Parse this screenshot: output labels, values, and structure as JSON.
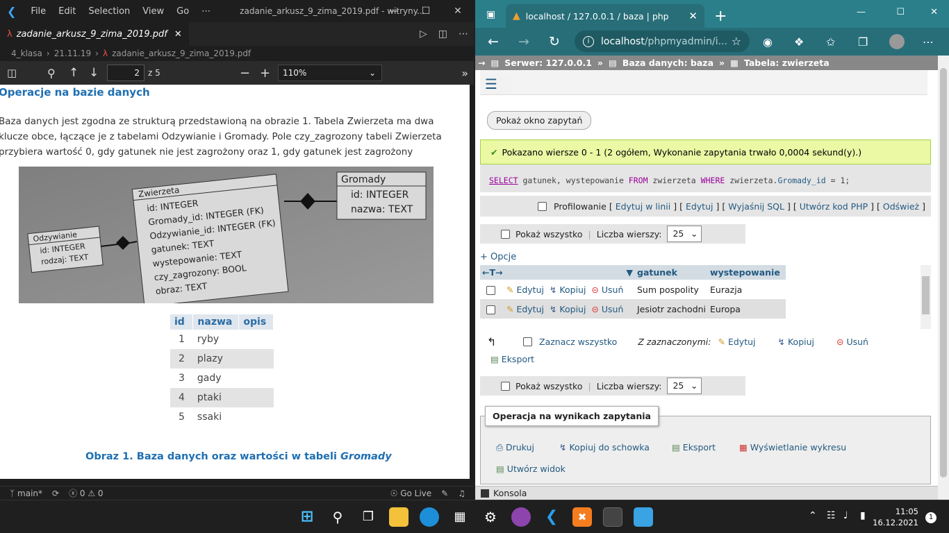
{
  "vscode": {
    "menu": [
      "File",
      "Edit",
      "Selection",
      "View",
      "Go",
      "⋯"
    ],
    "window_title": "zadanie_arkusz_9_zima_2019.pdf - witryny...",
    "tab_label": "zadanie_arkusz_9_zima_2019.pdf",
    "breadcrumb": [
      "4_klasa",
      "21.11.19",
      "zadanie_arkusz_9_zima_2019.pdf"
    ],
    "page_current": "2",
    "page_total": "z 5",
    "zoom": "110%",
    "status": {
      "branch": "main*",
      "problems": "ⓧ 0 ⚠ 0",
      "golive": "Go Live"
    }
  },
  "pdf": {
    "heading": "Operacje na bazie danych",
    "paragraph": "Baza danych jest zgodna ze strukturą przedstawioną na obrazie 1. Tabela Zwierzeta ma dwa klucze obce, łączące je z tabelami Odzywianie i Gromady. Pole czy_zagrozony tabeli Zwierzeta przybiera wartość 0, gdy gatunek nie jest zagrożony oraz 1, gdy gatunek jest zagrożony",
    "erd": {
      "odzywianie": {
        "title": "Odzywianie",
        "fields": [
          "id: INTEGER",
          "rodzaj: TEXT"
        ]
      },
      "zwierzeta": {
        "title": "Zwierzeta",
        "fields": [
          "id: INTEGER",
          "Gromady_id: INTEGER (FK)",
          "Odzywianie_id: INTEGER (FK)",
          "gatunek: TEXT",
          "wystepowanie: TEXT",
          "czy_zagrozony: BOOL",
          "obraz: TEXT"
        ]
      },
      "gromady": {
        "title": "Gromady",
        "fields": [
          "id: INTEGER",
          "nazwa: TEXT"
        ]
      }
    },
    "table": {
      "headers": [
        "id",
        "nazwa",
        "opis"
      ],
      "rows": [
        [
          "1",
          "ryby",
          ""
        ],
        [
          "2",
          "plazy",
          ""
        ],
        [
          "3",
          "gady",
          ""
        ],
        [
          "4",
          "ptaki",
          ""
        ],
        [
          "5",
          "ssaki",
          ""
        ]
      ]
    },
    "caption_prefix": "Obraz 1. Baza danych oraz wartości w tabeli ",
    "caption_italic": "Gromady"
  },
  "edge": {
    "tab_title": "localhost / 127.0.0.1 / baza | php",
    "url_host": "localhost",
    "url_path": "/phpmyadmin/i..."
  },
  "pma": {
    "breadcrumb": {
      "server": "Serwer: 127.0.0.1",
      "db": "Baza danych: baza",
      "table": "Tabela: zwierzeta"
    },
    "show_query_btn": "Pokaż okno zapytań",
    "success_msg": "Pokazano wiersze 0 - 1 (2 ogółem, Wykonanie zapytania trwało 0,0004 sekund(y).)",
    "sql": {
      "select": "SELECT",
      "cols": " gatunek, wystepowanie ",
      "from": "FROM",
      "tbl": " zwierzeta ",
      "where": "WHERE",
      "cond": " zwierzeta.",
      "col2": "Gromady_id",
      "eq": " = 1;"
    },
    "profiling": "Profilowanie",
    "profile_links": [
      "Edytuj w linii",
      "Edytuj",
      "Wyjaśnij SQL",
      "Utwórz kod PHP",
      "Odśwież"
    ],
    "show_all": "Pokaż wszystko",
    "rows_label": "Liczba wierszy:",
    "rows_value": "25",
    "options": "+ Opcje",
    "columns": [
      "gatunek",
      "wystepowanie"
    ],
    "row_actions": {
      "edit": "Edytuj",
      "copy": "Kopiuj",
      "delete": "Usuń"
    },
    "rows": [
      [
        "Sum pospolity",
        "Eurazja"
      ],
      [
        "Jesiotr zachodni",
        "Europa"
      ]
    ],
    "check_all": "Zaznacz wszystko",
    "with_selected": "Z zaznaczonymi:",
    "export": "Eksport",
    "ops_title": "Operacja na wynikach zapytania",
    "ops": {
      "print": "Drukuj",
      "copy_clip": "Kopiuj do schowka",
      "export": "Eksport",
      "chart": "Wyświetlanie wykresu",
      "view": "Utwórz widok"
    },
    "console": "Konsola"
  },
  "taskbar": {
    "time": "11:05",
    "date": "16.12.2021",
    "notif": "1"
  }
}
